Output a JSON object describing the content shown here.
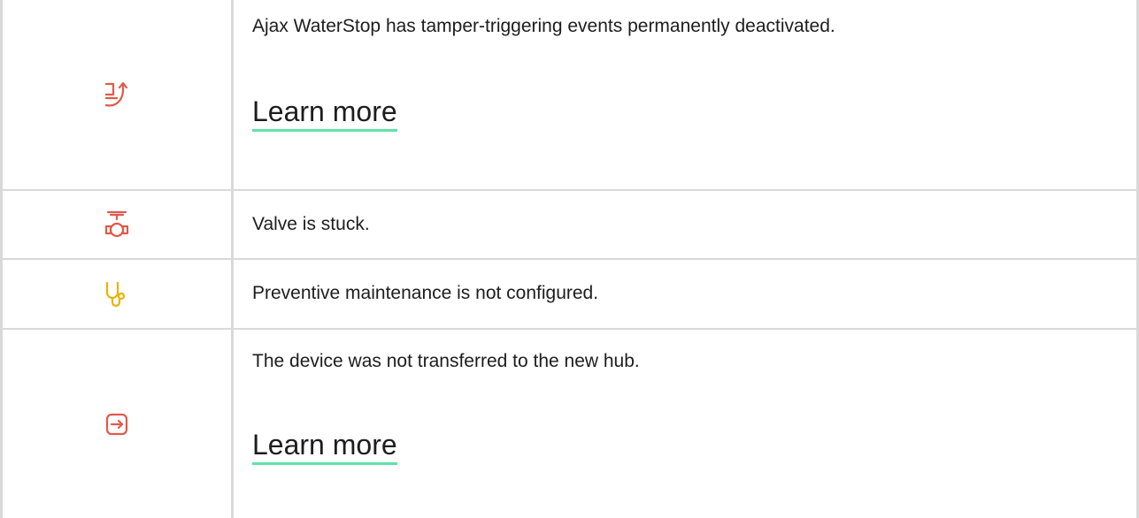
{
  "rows": [
    {
      "icon": "tamper-pipe-icon",
      "icon_color": "#e05a4a",
      "text": "Ajax WaterStop has tamper-triggering events permanently deactivated.",
      "link": "Learn more"
    },
    {
      "icon": "valve-icon",
      "icon_color": "#e05a4a",
      "text": "Valve is stuck."
    },
    {
      "icon": "stethoscope-icon",
      "icon_color": "#e8b400",
      "text": "Preventive maintenance is not configured."
    },
    {
      "icon": "transfer-arrow-icon",
      "icon_color": "#e05a4a",
      "text": "The device was not transferred to the new hub.",
      "link": "Learn more"
    }
  ],
  "colors": {
    "border": "#d9d9d9",
    "link_underline": "#5fe3a4",
    "text": "#1d1d1d"
  }
}
